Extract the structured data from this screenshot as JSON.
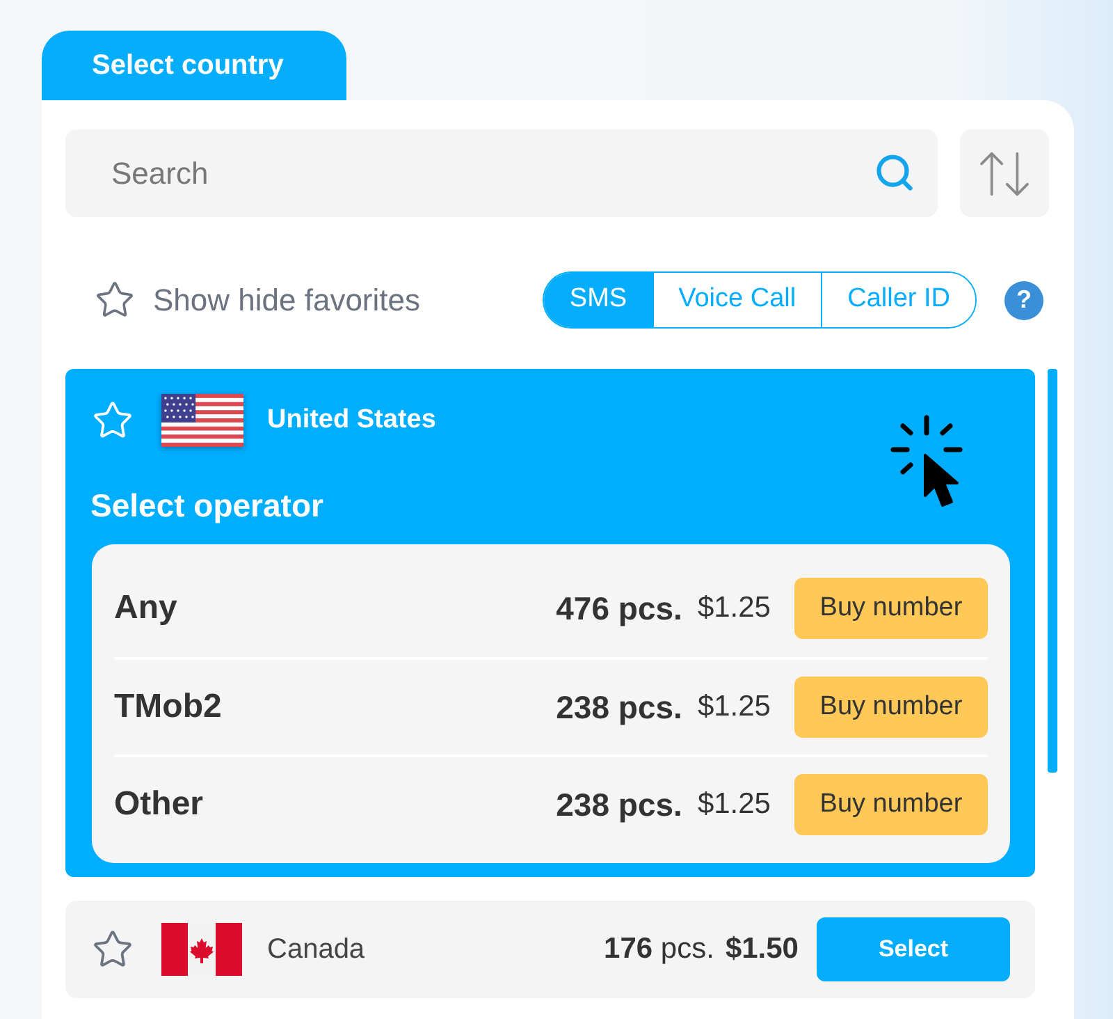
{
  "panel_tab": {
    "label": "Select country"
  },
  "search": {
    "placeholder": "Search"
  },
  "favorites_filter": {
    "label": "Show hide favorites"
  },
  "service_tabs": [
    {
      "label": "SMS",
      "selected": true
    },
    {
      "label": "Voice Call",
      "selected": false
    },
    {
      "label": "Caller ID",
      "selected": false
    }
  ],
  "help_button": {
    "label": "?"
  },
  "countries": [
    {
      "name": "United States",
      "flag": {
        "kind": "us"
      },
      "favorite": false,
      "expanded": true,
      "operator_heading": "Select operator",
      "operators": [
        {
          "name": "Any",
          "count": "476 pcs.",
          "price": "$1.25",
          "action": "Buy number"
        },
        {
          "name": "TMob2",
          "count": "238 pcs.",
          "price": "$1.25",
          "action": "Buy number"
        },
        {
          "name": "Other",
          "count": "238 pcs.",
          "price": "$1.25",
          "action": "Buy number"
        }
      ]
    },
    {
      "name": "Canada",
      "flag": {
        "kind": "ca"
      },
      "favorite": false,
      "expanded": false,
      "count": "**176** pcs.",
      "price": "$1.50",
      "action": "Select"
    }
  ]
}
